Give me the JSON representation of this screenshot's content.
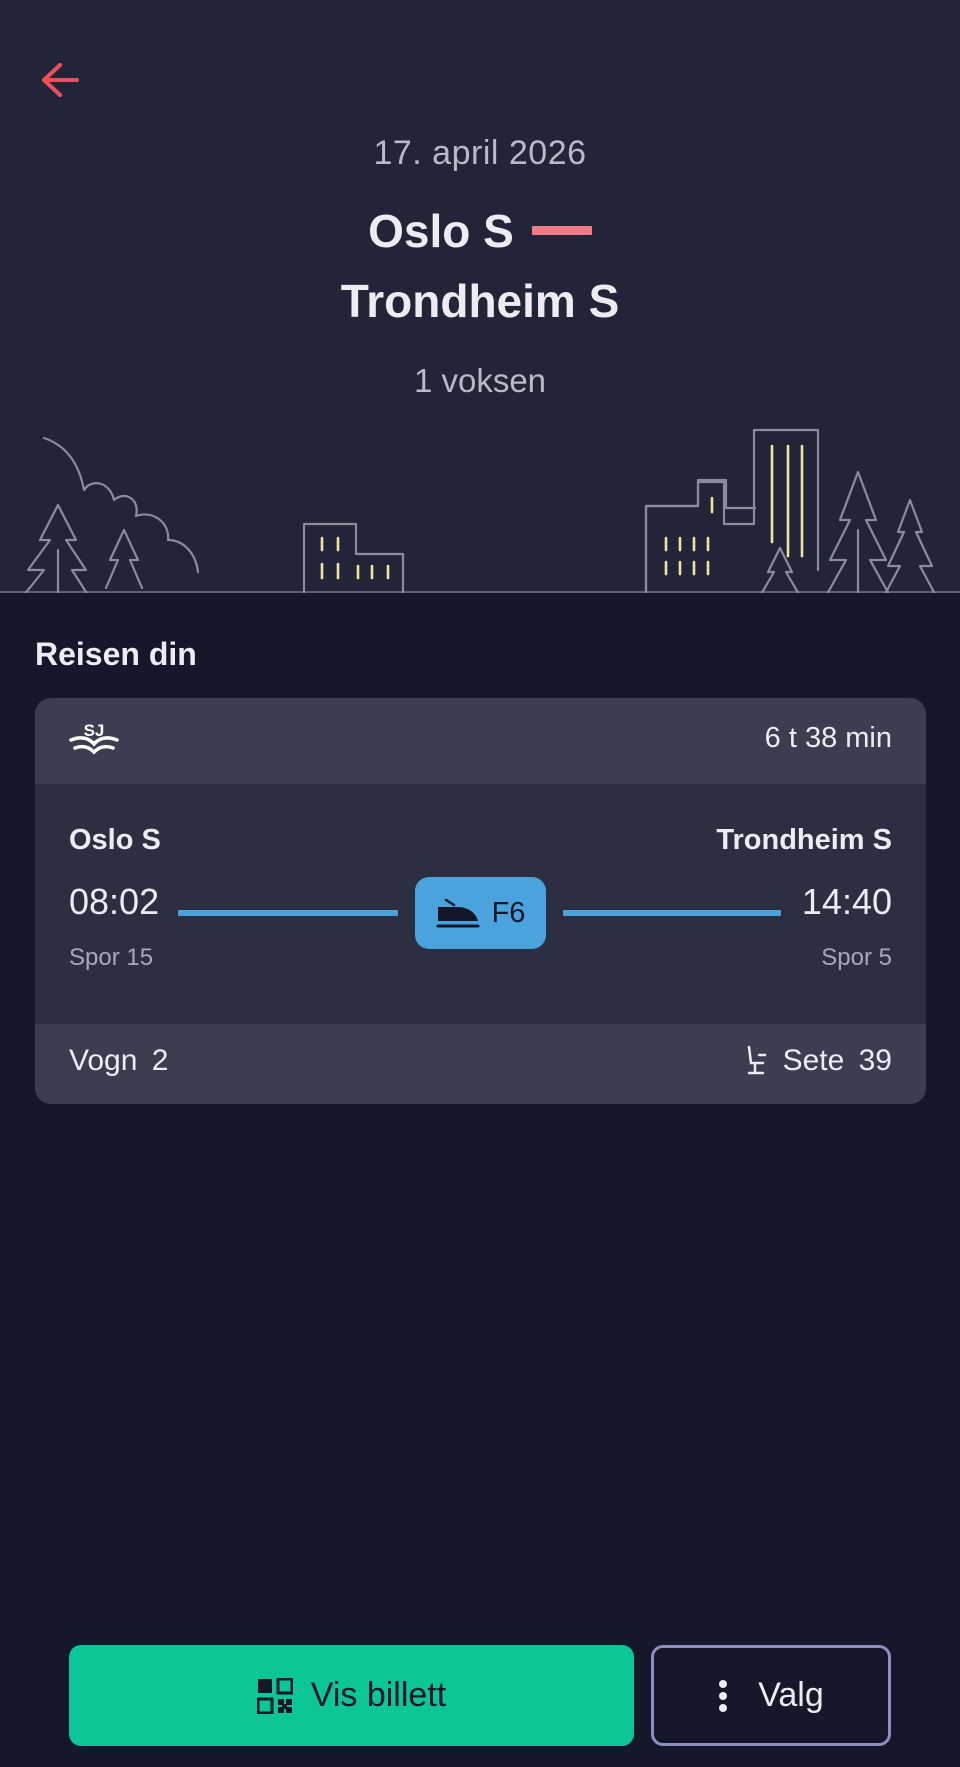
{
  "header": {
    "date": "17. april 2026",
    "origin": "Oslo S",
    "destination": "Trondheim S",
    "passengers": "1 voksen",
    "back_icon": "arrow-left-icon"
  },
  "journey": {
    "section_title": "Reisen din",
    "operator_logo": "SJ",
    "duration": "6 t 38 min",
    "from_station": "Oslo S",
    "to_station": "Trondheim S",
    "departure_time": "08:02",
    "arrival_time": "14:40",
    "train_line": "F6",
    "departure_track": "Spor 15",
    "arrival_track": "Spor 5",
    "wagon": "Vogn 2",
    "seat": "Sete 39"
  },
  "actions": {
    "show_ticket": "Vis billett",
    "options": "Valg"
  },
  "colors": {
    "accent_red": "#f0505e",
    "line_blue": "#4aa3dc",
    "primary_green": "#0bc796",
    "window_yellow": "#f3e3a0"
  }
}
